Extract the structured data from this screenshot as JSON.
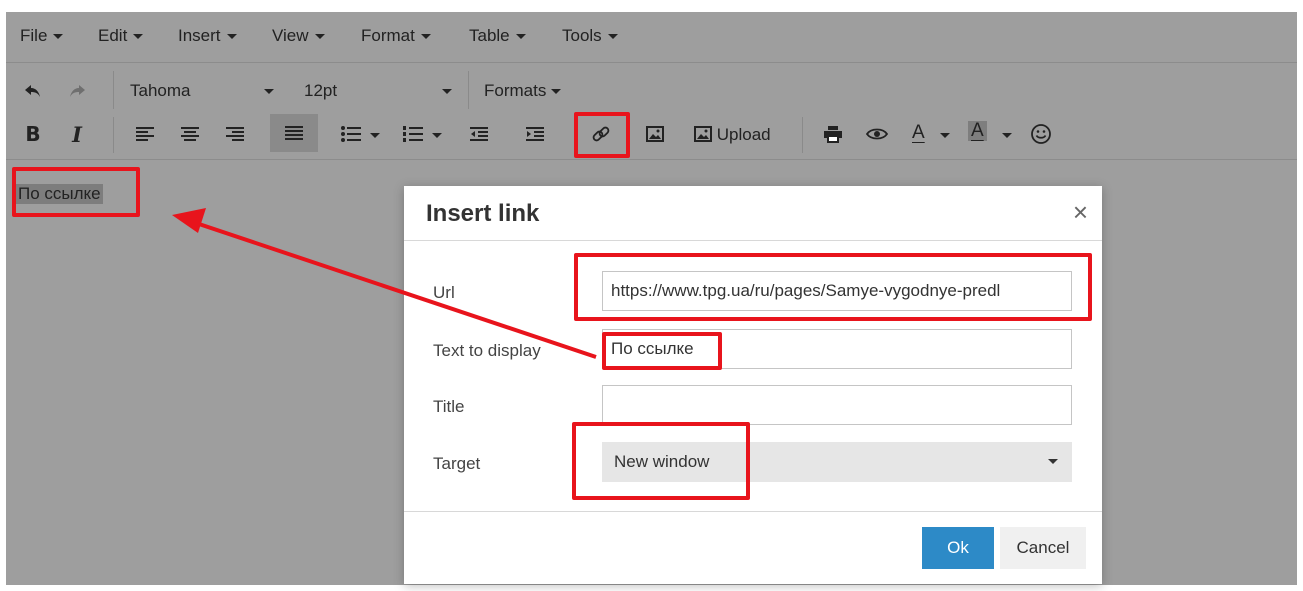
{
  "menubar": {
    "items": [
      {
        "label": "File"
      },
      {
        "label": "Edit"
      },
      {
        "label": "Insert"
      },
      {
        "label": "View"
      },
      {
        "label": "Format"
      },
      {
        "label": "Table"
      },
      {
        "label": "Tools"
      }
    ]
  },
  "toolbar": {
    "font_family": "Tahoma",
    "font_size": "12pt",
    "formats_label": "Formats",
    "upload_label": "Upload",
    "bold_label": "B",
    "italic_label": "I",
    "text_color_label": "A",
    "bg_color_label": "A"
  },
  "editor": {
    "selected_text": "По ссылке"
  },
  "dialog": {
    "title": "Insert link",
    "close_glyph": "×",
    "url_label": "Url",
    "url_value": "https://www.tpg.ua/ru/pages/Samye-vygodnye-predl",
    "text_label": "Text to display",
    "text_value": "По ссылке",
    "title_label": "Title",
    "title_value": "",
    "target_label": "Target",
    "target_value": "New window",
    "ok_label": "Ok",
    "cancel_label": "Cancel"
  },
  "colors": {
    "accent": "#2d8ac7",
    "highlight": "#e8141c",
    "chrome": "#9e9e9e"
  }
}
